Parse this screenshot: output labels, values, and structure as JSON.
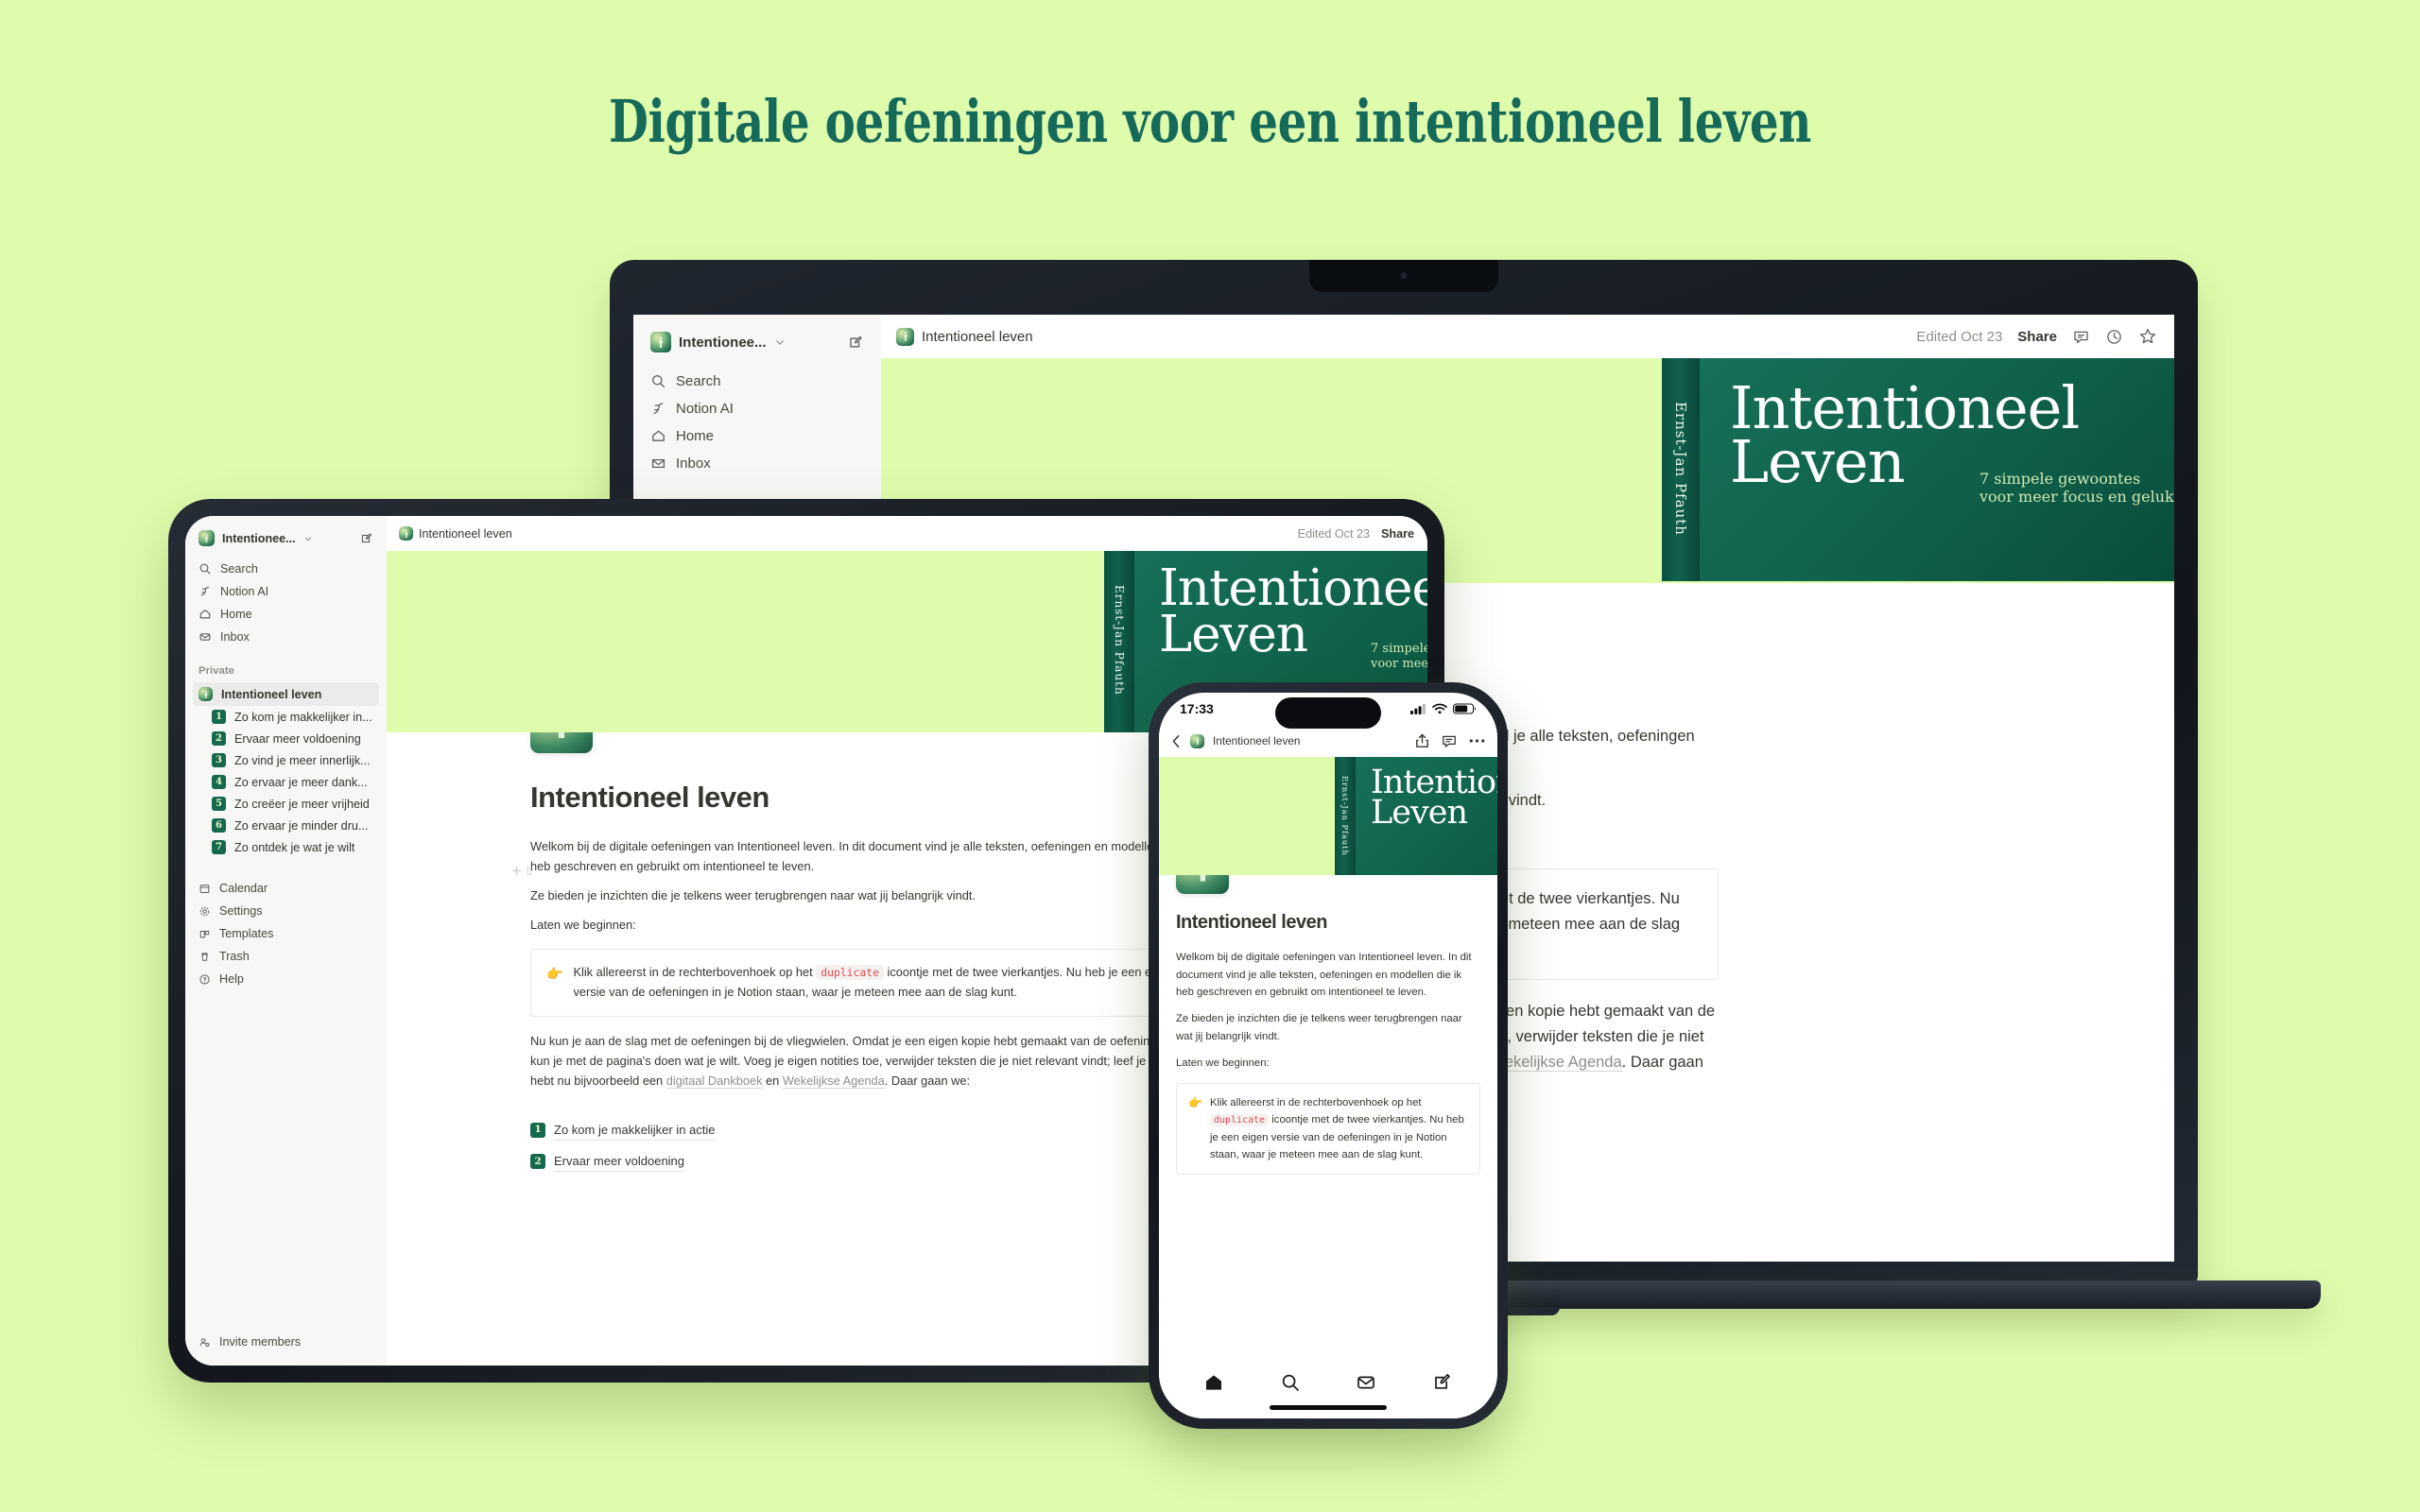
{
  "headline": "Digitale oefeningen voor een intentioneel leven",
  "theme": {
    "background": "#dffcad",
    "headline_color": "#156a5a",
    "brand_green": "#16684f",
    "code_red": "#e5484d"
  },
  "book": {
    "title_line1": "Intentioneel",
    "title_line2": "Leven",
    "subtitle_line1": "7 simpele gewoontes",
    "subtitle_line2": "voor meer focus en geluk",
    "author_spine": "Ernst-Jan Pfauth"
  },
  "sidebar": {
    "workspace_name": "Intentionee...",
    "nav": [
      {
        "label": "Search",
        "icon": "search-icon"
      },
      {
        "label": "Notion AI",
        "icon": "sparkle-icon"
      },
      {
        "label": "Home",
        "icon": "home-icon"
      },
      {
        "label": "Inbox",
        "icon": "inbox-icon"
      }
    ],
    "section_private": "Private",
    "active_page": "Intentioneel leven",
    "pages": [
      {
        "num": "1",
        "label": "Zo kom je makkelijker in..."
      },
      {
        "num": "2",
        "label": "Ervaar meer voldoening"
      },
      {
        "num": "3",
        "label": "Zo vind je meer innerlijk..."
      },
      {
        "num": "4",
        "label": "Zo ervaar je meer dank..."
      },
      {
        "num": "5",
        "label": "Zo creëer je meer vrijheid"
      },
      {
        "num": "6",
        "label": "Zo ervaar je minder dru..."
      },
      {
        "num": "7",
        "label": "Zo ontdek je wat je wilt"
      }
    ],
    "bottom": [
      {
        "label": "Calendar",
        "icon": "calendar-icon"
      },
      {
        "label": "Settings",
        "icon": "gear-icon"
      },
      {
        "label": "Templates",
        "icon": "templates-icon"
      },
      {
        "label": "Trash",
        "icon": "trash-icon"
      },
      {
        "label": "Help",
        "icon": "help-icon"
      }
    ],
    "invite": "Invite members"
  },
  "topbar": {
    "breadcrumb": "Intentioneel leven",
    "edited": "Edited Oct 23",
    "share": "Share",
    "icons": [
      "comment-icon",
      "history-icon",
      "star-icon"
    ]
  },
  "document": {
    "title": "Intentioneel leven",
    "p1": "Welkom bij de digitale oefeningen van Intentioneel leven. In dit document vind je alle teksten, oefeningen en modellen die ik heb geschreven en gebruikt om intentioneel te leven.",
    "p2": "Ze bieden je inzichten die je telkens weer terugbrengen naar wat jij belangrijk vindt.",
    "p3": "Laten we beginnen:",
    "callout_emoji": "👉",
    "callout_a": "Klik allereerst in de rechterbovenhoek op het ",
    "callout_code": "duplicate",
    "callout_b": " icoontje met de twee vierkantjes. Nu heb je een eigen versie van de oefeningen in je Notion staan, waar je meteen mee aan de slag kunt.",
    "p4_a": "Nu kun je aan de slag met de oefeningen bij de vliegwielen. Omdat je een eigen kopie hebt gemaakt van de oefeningen, kun je met de pagina's doen wat je wilt. Voeg je eigen notities toe, verwijder teksten die je niet relevant vindt; leef je uit. Je hebt nu bijvoorbeeld een ",
    "p4_link1": "digitaal Dankboek",
    "p4_mid": " en ",
    "p4_link2": "Wekelijkse Agenda",
    "p4_end": ". Daar gaan we:",
    "toc": [
      {
        "num": "1",
        "label": "Zo kom je makkelijker in actie"
      },
      {
        "num": "2",
        "label": "Ervaar meer voldoening"
      }
    ]
  },
  "phone": {
    "status_time": "17:33",
    "breadcrumb": "Intentioneel leven",
    "header_icons": [
      "back-icon",
      "share-icon",
      "comment-icon",
      "more-icon"
    ],
    "nav_icons": [
      "home-icon",
      "search-icon",
      "inbox-icon",
      "compose-icon"
    ]
  }
}
